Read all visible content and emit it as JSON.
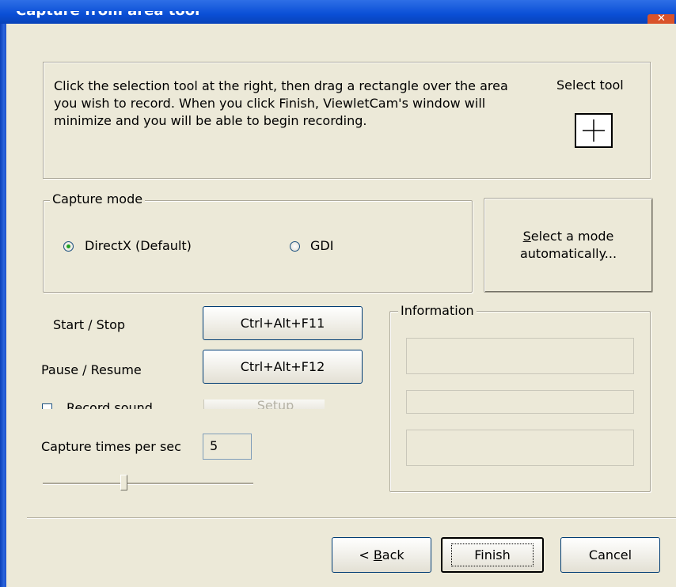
{
  "window": {
    "title": "Capture from area tool",
    "close_icon": "close-icon"
  },
  "instructions": {
    "text": "Click the selection tool at the right, then drag a rectangle over the area you wish to record. When you click Finish, ViewletCam's window will minimize and you will be able to begin recording.",
    "select_tool_label": "Select tool",
    "select_tool_icon": "crosshair-icon"
  },
  "capture_mode": {
    "legend": "Capture mode",
    "options": [
      {
        "label": "DirectX (Default)",
        "selected": true
      },
      {
        "label": "GDI",
        "selected": false
      }
    ],
    "auto_button": {
      "accel": "S",
      "rest_line1": "elect a mode",
      "line2": "automatically..."
    }
  },
  "hotkeys": {
    "start_stop_label": "Start / Stop",
    "start_stop_key": "Ctrl+Alt+F11",
    "pause_resume_label": "Pause / Resume",
    "pause_resume_key": "Ctrl+Alt+F12",
    "record_sound_label": "Record sound",
    "record_sound_checked": false,
    "setup_label": "Setup"
  },
  "capture_rate": {
    "label": "Capture times per sec",
    "value": "5",
    "slider_level": 0.38
  },
  "information": {
    "legend": "Information",
    "fields": [
      "",
      "",
      ""
    ]
  },
  "footer": {
    "back_accel": "B",
    "back_prefix": "< ",
    "back_rest": "ack",
    "finish": "Finish",
    "cancel": "Cancel"
  },
  "colors": {
    "face": "#ECE9D8",
    "titlebar": "#0A4FD6",
    "close": "#D9522A",
    "radio_dot": "#21A121",
    "button_border": "#003C74"
  }
}
